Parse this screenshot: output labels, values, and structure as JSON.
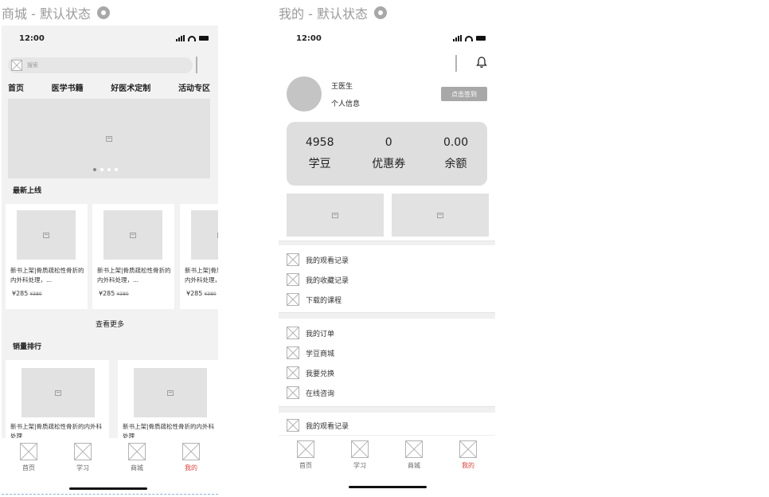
{
  "left": {
    "frame_title": "商城 - 默认状态",
    "status_time": "12:00",
    "search_placeholder": "搜索",
    "categories": [
      "首页",
      "医学书籍",
      "好医术定制",
      "活动专区"
    ],
    "section_new": "最新上线",
    "new_books": [
      {
        "title": "新书上架|骨质疏松性骨折的内外科处理，...",
        "price": "¥285",
        "old_price": "¥380"
      },
      {
        "title": "新书上架|骨质疏松性骨折的内外科处理，...",
        "price": "¥285",
        "old_price": "¥380"
      },
      {
        "title": "新书上架|骨质疏松性骨折的内外科处理，...",
        "price": "¥285",
        "old_price": "¥380"
      }
    ],
    "more_label": "查看更多",
    "section_rank": "销量排行",
    "rank_books": [
      {
        "title": "新书上架|骨质疏松性骨折的内外科处理"
      },
      {
        "title": "新书上架|骨质疏松性骨折的内外科处理"
      }
    ],
    "tabs": [
      "首页",
      "学习",
      "商城",
      "我的"
    ],
    "active_tab": "我的"
  },
  "right": {
    "frame_title": "我的 - 默认状态",
    "status_time": "12:00",
    "user_name": "王医生",
    "user_info": "个人信息",
    "checkin_label": "点击签到",
    "stats": [
      {
        "value": "4958",
        "label": "学豆"
      },
      {
        "value": "0",
        "label": "优惠券"
      },
      {
        "value": "0.00",
        "label": "余额"
      }
    ],
    "menu_group1": [
      "我的观看记录",
      "我的收藏记录",
      "下载的课程"
    ],
    "menu_group2": [
      "我的订单",
      "学豆商城",
      "我要兑换",
      "在线咨询"
    ],
    "menu_group3": [
      "我的观看记录"
    ],
    "tabs": [
      "首页",
      "学习",
      "商城",
      "我的"
    ],
    "active_tab": "我的"
  },
  "colors": {
    "accent": "#d9433a",
    "background": "#f2f2f2",
    "placeholder": "#e2e2e2",
    "checkin_button": "#a8a8a8"
  }
}
